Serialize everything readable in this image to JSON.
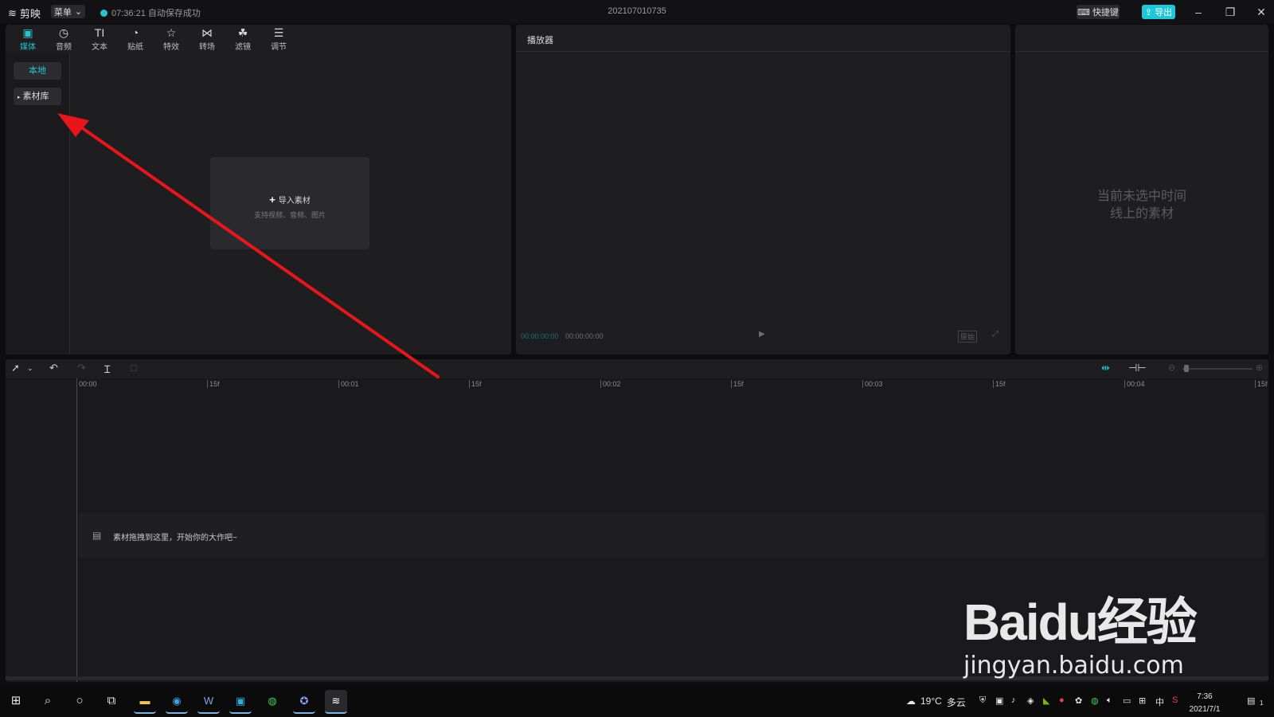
{
  "titlebar": {
    "app_name": "剪映",
    "menu_label": "菜单",
    "autosave_text": "07:36:21 自动保存成功",
    "project_name": "202107010735",
    "shortcut_label": "快捷键",
    "export_label": "导出"
  },
  "media_tabs": [
    {
      "label": "媒体",
      "icon": "media-icon"
    },
    {
      "label": "音频",
      "icon": "audio-icon"
    },
    {
      "label": "文本",
      "icon": "text-icon"
    },
    {
      "label": "贴纸",
      "icon": "sticker-icon"
    },
    {
      "label": "特效",
      "icon": "effects-icon"
    },
    {
      "label": "转场",
      "icon": "transition-icon"
    },
    {
      "label": "滤镜",
      "icon": "filter-icon"
    },
    {
      "label": "调节",
      "icon": "adjust-icon"
    }
  ],
  "media_sidebar": {
    "local_label": "本地",
    "library_label": "素材库"
  },
  "import_box": {
    "label": "导入素材",
    "sub": "支持视频、音频、图片"
  },
  "player": {
    "title": "播放器",
    "current_time": "00:00:00:00",
    "total_time": "00:00:00:00",
    "ratio_label": "原始"
  },
  "detail": {
    "empty_line1": "当前未选中时间",
    "empty_line2": "线上的素材"
  },
  "timeline": {
    "ruler": [
      "00:00",
      "15f",
      "00:01",
      "15f",
      "00:02",
      "15f",
      "00:03",
      "15f",
      "00:04",
      "15f"
    ],
    "hint": "素材拖拽到这里，开始你的大作吧~"
  },
  "taskbar": {
    "weather_temp": "19°C",
    "weather_desc": "多云",
    "ime": "中",
    "time": "7:36",
    "date": "2021/7/1",
    "notification_count": "1"
  },
  "watermark": {
    "brand": "Baidu经验",
    "url": "jingyan.baidu.com"
  },
  "colors": {
    "accent": "#26c3d1",
    "arrow": "#e8151b",
    "panel": "#1e1e21"
  }
}
